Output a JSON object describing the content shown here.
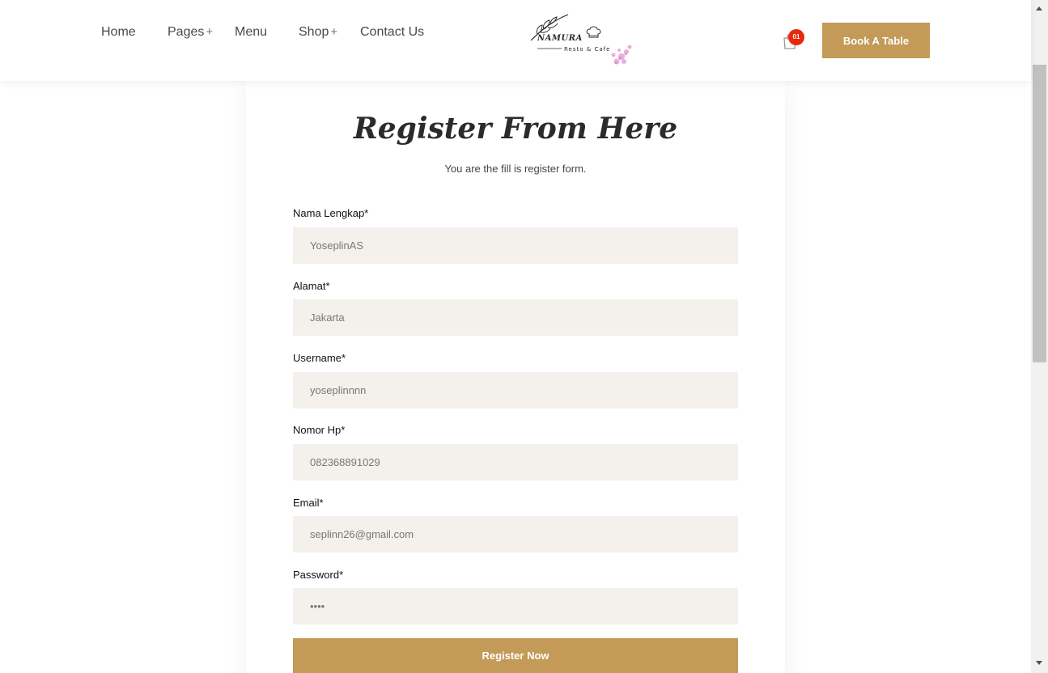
{
  "nav": {
    "home": "Home",
    "pages": "Pages",
    "menu": "Menu",
    "shop": "Shop",
    "contact": "Contact Us",
    "plus": "+"
  },
  "logo": {
    "brand": "NAMURA",
    "tagline": "Resto & Cafe"
  },
  "cart": {
    "count": "01"
  },
  "header": {
    "book_label": "Book A Table"
  },
  "form": {
    "title": "Register From Here",
    "subtitle": "You are the fill is register form.",
    "fields": [
      {
        "label": "Nama Lengkap*",
        "value": "YoseplinAS"
      },
      {
        "label": "Alamat*",
        "value": "Jakarta"
      },
      {
        "label": "Username*",
        "value": "yoseplinnnn"
      },
      {
        "label": "Nomor Hp*",
        "value": "082368891029"
      },
      {
        "label": "Email*",
        "value": "seplinn26@gmail.com"
      },
      {
        "label": "Password*",
        "value": "••••"
      }
    ],
    "submit_label": "Register Now"
  },
  "colors": {
    "accent": "#c49a58",
    "badge": "#e8290b",
    "input_bg": "#f4f0ec"
  }
}
